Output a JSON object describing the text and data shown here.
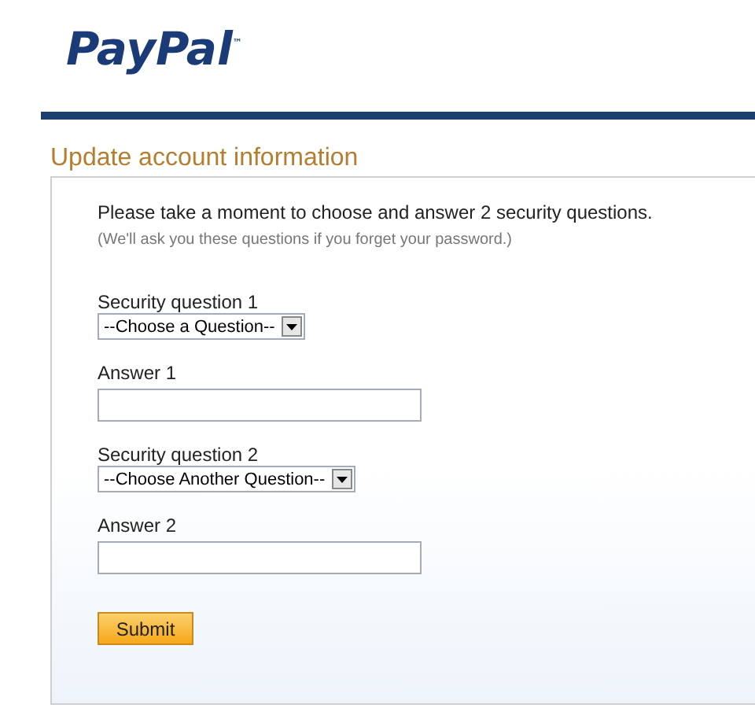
{
  "logo": "PayPal$^{™}$",
  "heading": "Update account information",
  "intro": "Please take a moment to choose and answer 2 security questions.",
  "note": "(We'll ask you these questions if you forget your password.)",
  "fields": [
    {
      "kind": "select",
      "label": "Security question 1",
      "value": "--Choose a Question--"
    },
    {
      "kind": "input",
      "label": "Answer 1"
    },
    {
      "kind": "select",
      "label": "Security question 2",
      "value": "--Choose Another Question--"
    },
    {
      "kind": "input",
      "label": "Answer 2"
    }
  ],
  "submit": "Submit"
}
